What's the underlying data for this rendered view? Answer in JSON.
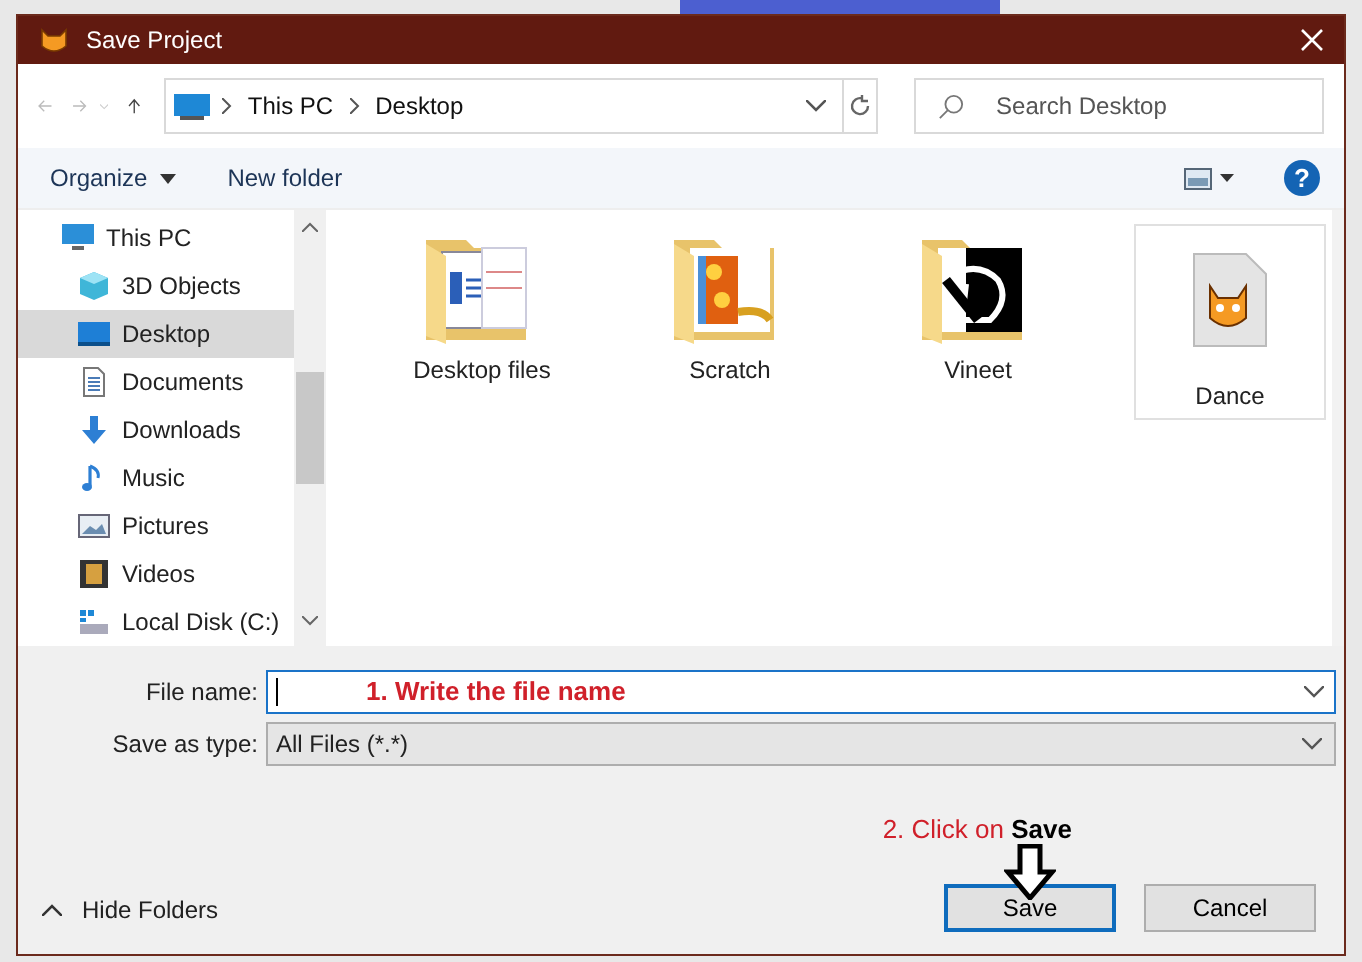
{
  "window": {
    "title": "Save Project"
  },
  "address": {
    "crumbs": [
      "This PC",
      "Desktop"
    ]
  },
  "search": {
    "placeholder": "Search Desktop"
  },
  "toolbar": {
    "organize": "Organize",
    "new_folder": "New folder"
  },
  "sidebar": {
    "items": [
      {
        "label": "This PC",
        "selected": false,
        "children": [
          {
            "label": "3D Objects",
            "selected": false
          },
          {
            "label": "Desktop",
            "selected": true
          },
          {
            "label": "Documents",
            "selected": false
          },
          {
            "label": "Downloads",
            "selected": false
          },
          {
            "label": "Music",
            "selected": false
          },
          {
            "label": "Pictures",
            "selected": false
          },
          {
            "label": "Videos",
            "selected": false
          },
          {
            "label": "Local Disk (C:)",
            "selected": false
          }
        ]
      }
    ]
  },
  "files": [
    {
      "name": "Desktop files",
      "kind": "folder"
    },
    {
      "name": "Scratch",
      "kind": "folder"
    },
    {
      "name": "Vineet",
      "kind": "folder"
    },
    {
      "name": "Dance",
      "kind": "file"
    }
  ],
  "help": "?",
  "form": {
    "file_name_label": "File name:",
    "save_type_label": "Save as type:",
    "save_type_value": "All Files (*.*)"
  },
  "annotations": {
    "step1": "1. Write the file name",
    "step2": "2. Click on **Save**"
  },
  "footer": {
    "hide_folders": "Hide Folders",
    "buttons": [
      {
        "label": "Save",
        "kind": "primary"
      },
      {
        "label": "Cancel",
        "kind": "normal"
      }
    ]
  }
}
